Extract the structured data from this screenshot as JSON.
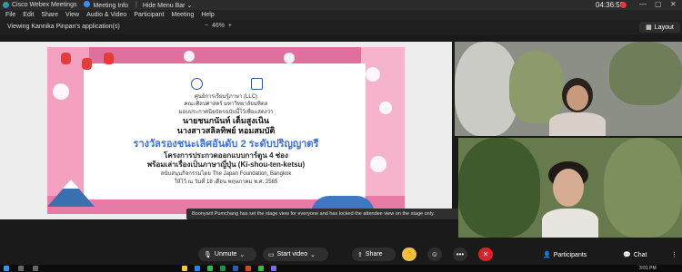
{
  "titlebar": {
    "app_name": "Cisco Webex Meetings",
    "meeting_info": "Meeting Info",
    "hide_menu": "Hide Menu Bar",
    "hide_menu_arrow": "⌄",
    "clock": "04:36:58"
  },
  "menu": {
    "file": "File",
    "edit": "Edit",
    "share": "Share",
    "view": "View",
    "audio_video": "Audio & Video",
    "participant": "Participant",
    "meeting": "Meeting",
    "help": "Help"
  },
  "viewing": {
    "label": "Viewing Kannika Pinpan's application(s)",
    "zoom": "46%",
    "zoom_minus": "−",
    "zoom_plus": "+",
    "layout": "Layout"
  },
  "slide": {
    "center_org": "ศูนย์การเรียนรู้ภาษา (LLC)",
    "faculty": "คณะศิลปศาสตร์ มหาวิทยาลัยมหิดล",
    "present_line": "มอบประกาศนียบัตรฉบับนี้ไว้เพื่อแสดงว่า",
    "name1": "นายชนกนันท์ เต็มสูงเนิน",
    "name2": "นางสาวสลิลทิพย์ หอมสมบัติ",
    "award": "รางวัลรองชนะเลิศอันดับ 2 ระดับปริญญาตรี",
    "project1": "โครงการประกวดออกแบบการ์ตูน 4 ช่อง",
    "project2": "พร้อมเล่าเรื่องเป็นภาษาญี่ปุ่น (Ki-shou-ten-ketsu)",
    "sponsor": "สนับสนุนกิจกรรมโดย The Japan Foundation, Bangkok",
    "date": "ให้ไว้ ณ วันที่ 18 เดือน พฤษภาคม พ.ศ. 2565"
  },
  "toast": "Boonyarit Pumchang has set the stage view for everyone and has locked the attendee view on the stage only.",
  "controls": {
    "unmute": "Unmute",
    "start_video": "Start video",
    "share": "Share",
    "participants": "Participants",
    "chat": "Chat",
    "more": "•••",
    "end": "✕"
  },
  "taskbar": {
    "time": "3:01 PM"
  },
  "colors": {
    "accent_blue": "#3d6fd8",
    "end_red": "#d8232a",
    "border_pink": "#e06fa0"
  }
}
